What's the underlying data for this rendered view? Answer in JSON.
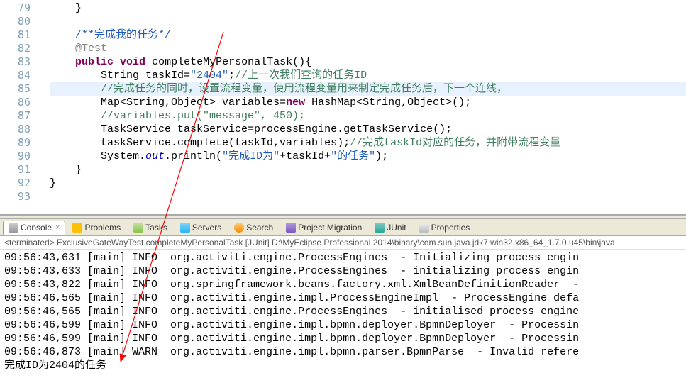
{
  "editor": {
    "lines": [
      {
        "num": "79",
        "html": "    }"
      },
      {
        "num": "80"
      },
      {
        "num": "81",
        "html": "    <span class='comment-doc'>/**完成我的任务*/</span>"
      },
      {
        "num": "82",
        "html": "    <span class='annot'>@Test</span>"
      },
      {
        "num": "83",
        "html": "    <span class='kw'>public</span> <span class='kw'>void</span> completeMyPersonalTask(){"
      },
      {
        "num": "84",
        "html": "        String taskId=<span class='str'>\"2404\"</span>;<span class='comment'>//上一次我们查询的任务ID</span>"
      },
      {
        "num": "85",
        "highlight": true,
        "html": "        <span class='comment'>//完成任务的同时，设置流程变量，使用流程变量用来制定完成任务后，下一个连线，</span>"
      },
      {
        "num": "86",
        "html": "        Map&lt;String,Object&gt; variables=<span class='kw'>new</span> HashMap&lt;String,Object&gt;();"
      },
      {
        "num": "87",
        "html": "        <span class='comment'>//variables.put(\"message\", 450);</span>"
      },
      {
        "num": "88",
        "html": "        TaskService taskService=processEngine.getTaskService();"
      },
      {
        "num": "89",
        "html": "        taskService.complete(taskId,variables);<span class='comment'>//完成taskId对应的任务，并附带流程变量</span>"
      },
      {
        "num": "90",
        "html": "        System.<span class='static-field'>out</span>.println(<span class='str'>\"完成ID为\"</span>+taskId+<span class='str'>\"的任务\"</span>);"
      },
      {
        "num": "91",
        "html": "    }"
      },
      {
        "num": "92",
        "html": "}"
      },
      {
        "num": "93"
      }
    ]
  },
  "tabs": [
    {
      "label": "Console",
      "active": true,
      "iconClass": "icon-console"
    },
    {
      "label": "Problems",
      "iconClass": "icon-problems"
    },
    {
      "label": "Tasks",
      "iconClass": "icon-tasks"
    },
    {
      "label": "Servers",
      "iconClass": "icon-servers"
    },
    {
      "label": "Search",
      "iconClass": "icon-search"
    },
    {
      "label": "Project Migration",
      "iconClass": "icon-migration"
    },
    {
      "label": "JUnit",
      "iconClass": "icon-junit"
    },
    {
      "label": "Properties",
      "iconClass": "icon-properties"
    }
  ],
  "terminated_line": "<terminated> ExclusiveGateWayTest.completeMyPersonalTask [JUnit] D:\\MyEclipse Professional 2014\\binary\\com.sun.java.jdk7.win32.x86_64_1.7.0.u45\\bin\\java",
  "console": [
    "09:56:43,631 [main] INFO  org.activiti.engine.ProcessEngines  - Initializing process engin",
    "09:56:43,633 [main] INFO  org.activiti.engine.ProcessEngines  - initializing process engin",
    "09:56:43,822 [main] INFO  org.springframework.beans.factory.xml.XmlBeanDefinitionReader  -",
    "09:56:46,565 [main] INFO  org.activiti.engine.impl.ProcessEngineImpl  - ProcessEngine defa",
    "09:56:46,565 [main] INFO  org.activiti.engine.ProcessEngines  - initialised process engine",
    "09:56:46,599 [main] INFO  org.activiti.engine.impl.bpmn.deployer.BpmnDeployer  - Processin",
    "09:56:46,599 [main] INFO  org.activiti.engine.impl.bpmn.deployer.BpmnDeployer  - Processin",
    "09:56:46,873 [main] WARN  org.activiti.engine.impl.bpmn.parser.BpmnParse  - Invalid refere",
    "完成ID为2404的任务"
  ]
}
